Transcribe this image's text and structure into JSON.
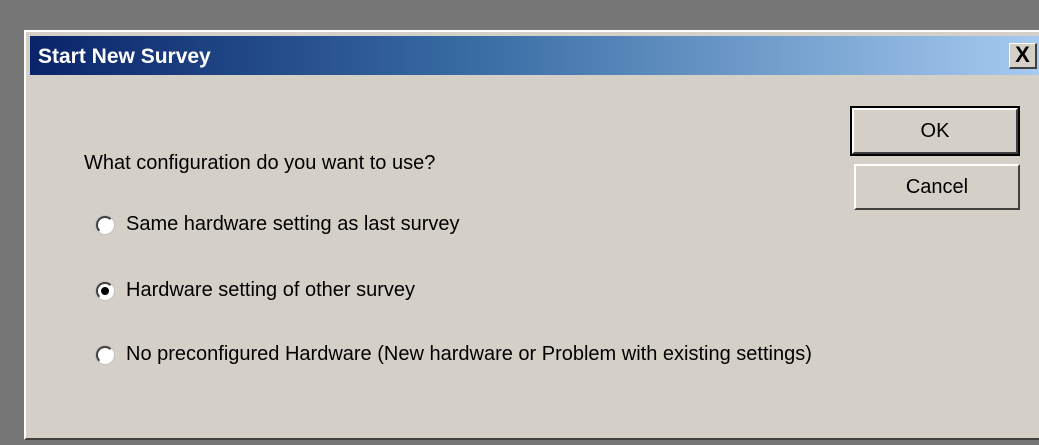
{
  "dialog": {
    "title": "Start New Survey",
    "close_glyph": "X",
    "prompt": "What configuration do you want to use?",
    "options": [
      {
        "label": "Same hardware setting as last survey",
        "selected": false
      },
      {
        "label": "Hardware setting of other survey",
        "selected": true
      },
      {
        "label": "No preconfigured Hardware (New hardware or Problem with existing settings)",
        "selected": false
      }
    ],
    "buttons": {
      "ok": "OK",
      "cancel": "Cancel"
    }
  },
  "colors": {
    "titlebar_start": "#0a246a",
    "titlebar_end": "#a6caf0",
    "face": "#d4d0c8",
    "backdrop": "#777777"
  },
  "icons": {
    "close": "close-icon",
    "radio": "radio-button"
  }
}
